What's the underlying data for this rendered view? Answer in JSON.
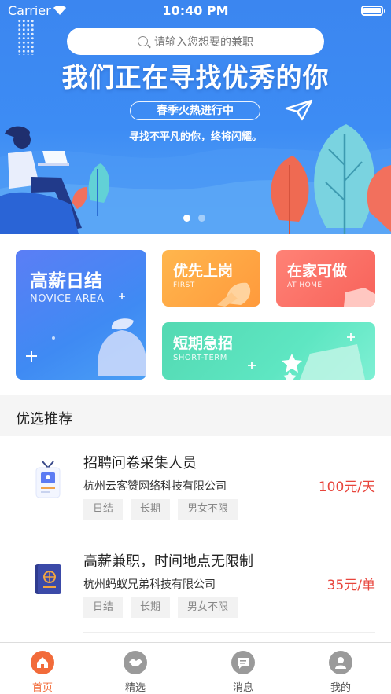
{
  "status_bar": {
    "carrier": "Carrier",
    "time": "10:40 PM"
  },
  "banner": {
    "search_placeholder": "请输入您想要的兼职",
    "headline": "我们正在寻找优秀的你",
    "tagline": "春季火热进行中",
    "subline": "寻找不平凡的你，终将闪耀。",
    "slide_count": 2,
    "active_slide": 1
  },
  "categories": [
    {
      "title": "高薪日结",
      "subtitle": "NOVICE AREA"
    },
    {
      "title": "优先上岗",
      "subtitle": "FIRST"
    },
    {
      "title": "在家可做",
      "subtitle": "AT HOME"
    },
    {
      "title": "短期急招",
      "subtitle": "SHORT-TERM"
    }
  ],
  "section": {
    "title": "优选推荐"
  },
  "jobs": [
    {
      "title": "招聘问卷采集人员",
      "company": "杭州云客赞网络科技有限公司",
      "salary": "100元/天",
      "tags": [
        "日结",
        "长期",
        "男女不限"
      ],
      "icon": "badge-icon"
    },
    {
      "title": "高薪兼职，时间地点无限制",
      "company": "杭州蚂蚁兄弟科技有限公司",
      "salary": "35元/单",
      "tags": [
        "日结",
        "长期",
        "男女不限"
      ],
      "icon": "passport-icon"
    }
  ],
  "tabbar": {
    "items": [
      {
        "label": "首页",
        "icon": "home-icon",
        "active": true
      },
      {
        "label": "精选",
        "icon": "handshake-icon",
        "active": false
      },
      {
        "label": "消息",
        "icon": "message-icon",
        "active": false
      },
      {
        "label": "我的",
        "icon": "user-icon",
        "active": false
      }
    ]
  },
  "colors": {
    "accent": "#f26b3a",
    "salary": "#e8453c",
    "banner": "#3d8cf4"
  }
}
